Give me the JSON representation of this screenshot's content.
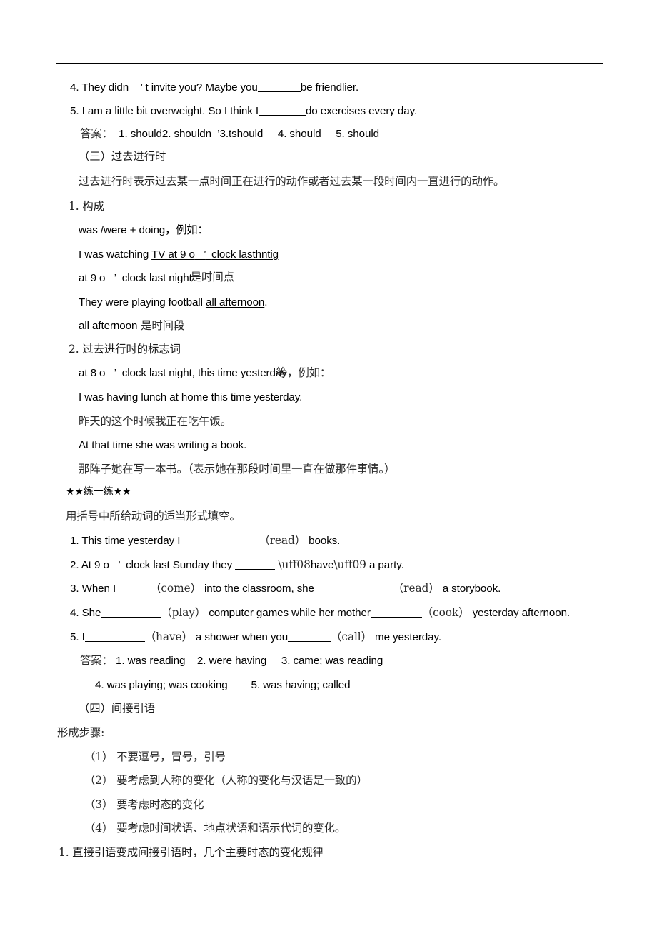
{
  "document": {
    "language": "zh-CN",
    "subject": "English grammar worksheet — past continuous tense and indirect speech",
    "rule_above_content": true
  },
  "exercises_modal_verbs": {
    "item4": {
      "number": "4.",
      "text_before": "They didn",
      "apostrophe": "’",
      "text_mid": "t invite you? Maybe you",
      "text_after": "be friendlier."
    },
    "item5": {
      "number": "5.",
      "text_before": "I am a little bit overweight. So I think I",
      "text_after": "do exercises every day."
    },
    "answers": {
      "label": "答案：",
      "run_together": "1. should2. shouldn",
      "apostrophe_cluster": "’3.t",
      "cluster_tail": "should",
      "item4": "4. should",
      "item5": "5. should"
    }
  },
  "section_past_continuous": {
    "heading": "（三）过去进行时",
    "definition": "过去进行时表示过去某一点时间正在进行的动作或者过去某一段时间内一直进行的动作。",
    "sub1_heading": "1. 构成",
    "formula": "was /were + doing，例如：",
    "example1_prefix": "I was watching ",
    "example1_underlined": "TV at 9 o",
    "example1_apostrophe": "’",
    "example1_clock": "clock last",
    "example1_garbled": "hntig",
    "example2_underlined": "at 9 o",
    "example2_apostrophe": "’",
    "example2_clock": "clock last night",
    "example2_overlap": "是时间点",
    "example3_prefix": "They were playing football ",
    "example3_underlined": "all afternoon",
    "example3_period": ".",
    "example3_note_underlined": "all afternoon",
    "example3_note_cn": " 是时间段",
    "sub2_heading": "2. 过去进行时的标志词",
    "signal_words": "at 8 o",
    "signal_apostrophe": "’",
    "signal_words_tail": "clock last night, this time yesterday",
    "signal_overlap_cn": "等，例如：",
    "example4_en": "I was having lunch at home this time yesterday.",
    "example4_cn": "昨天的这个时候我正在吃午饭。",
    "example5_en": "At that time she was writing a book.",
    "example5_cn": "那阵子她在写一本书。（表示她在那段时间里一直在做那件事情。）"
  },
  "practice": {
    "banner": "★★练一练★★",
    "instruction": "用括号中所给动词的适当形式填空。",
    "items": [
      {
        "number": "1.",
        "part1": "This time yesterday I",
        "hint": "（read）",
        "part2": " books."
      },
      {
        "number": "2.",
        "part1": "At 9 o",
        "apostrophe": "’",
        "part2": "clock last Sunday they ",
        "hint_underlined": "have",
        "part3": " a party."
      },
      {
        "number": "3.",
        "part1": "When I",
        "hint1": "（come）",
        "part2": " into the classroom, she",
        "hint2": "（read）",
        "part3": " a storybook."
      },
      {
        "number": "4.",
        "part1": "She",
        "hint1": "（play）",
        "part2": " computer games while her mother",
        "hint2": "（cook）",
        "part3": " yesterday afternoon."
      },
      {
        "number": "5.",
        "part1": "I",
        "hint1": "（have）",
        "part2": " a shower when you",
        "hint2": "（call）",
        "part3": " me yesterday."
      }
    ],
    "answers": {
      "label": "答案：",
      "a1": "1. was reading",
      "a2": "2. were having",
      "a3": "3. came; was reading",
      "a4": "4. was playing; was cooking",
      "a5": "5. was having; called"
    }
  },
  "section_indirect_speech": {
    "heading": "（四）间接引语",
    "steps_label": "形成步骤:",
    "steps": [
      "（1） 不要逗号，冒号，引号",
      "（2） 要考虑到人称的变化（人称的变化与汉语是一致的）",
      "（3） 要考虑时态的变化",
      "（4） 要考虑时间状语、地点状语和语示代词的变化。"
    ],
    "final_rule": "1. 直接引语变成间接引语时，几个主要时态的变化规律"
  }
}
